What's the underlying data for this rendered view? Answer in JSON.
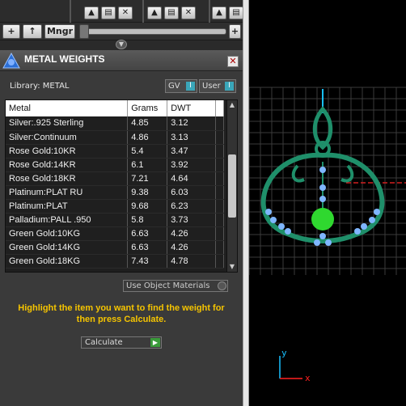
{
  "toolbar": {
    "manager_label": "Mngr",
    "plus_label": "+",
    "plus_right_label": "+"
  },
  "panel": {
    "title": "METAL WEIGHTS",
    "library_label": "Library: METAL",
    "gv_label": "GV",
    "user_label": "User",
    "toggle_indicator": "I"
  },
  "table": {
    "headers": [
      "Metal",
      "Grams",
      "DWT"
    ],
    "rows": [
      [
        "Silver:.925 Sterling",
        "4.85",
        "3.12"
      ],
      [
        "Silver:Continuum",
        "4.86",
        "3.13"
      ],
      [
        "Rose Gold:10KR",
        "5.4",
        "3.47"
      ],
      [
        "Rose Gold:14KR",
        "6.1",
        "3.92"
      ],
      [
        "Rose Gold:18KR",
        "7.21",
        "4.64"
      ],
      [
        "Platinum:PLAT RU",
        "9.38",
        "6.03"
      ],
      [
        "Platinum:PLAT",
        "9.68",
        "6.23"
      ],
      [
        "Palladium:PALL .950",
        "5.8",
        "3.73"
      ],
      [
        "Green Gold:10KG",
        "6.63",
        "4.26"
      ],
      [
        "Green Gold:14KG",
        "6.63",
        "4.26"
      ],
      [
        "Green Gold:18KG",
        "7.43",
        "4.78"
      ]
    ],
    "scroll_fraction": 0.5
  },
  "use_object_materials_label": "Use Object Materials",
  "instruction": "Highlight the item you want to find the weight for then press Calculate.",
  "calculate_label": "Calculate",
  "viewport": {
    "axis_y_label": "y",
    "axis_x_label": "x",
    "colors": {
      "grid": "#3a3a3a",
      "metal": "#1f8f6a",
      "gem": "#7fb6ff",
      "sphere": "#2fd82f",
      "axis_y": "#18c0ff",
      "axis_x": "#ff2020"
    }
  }
}
